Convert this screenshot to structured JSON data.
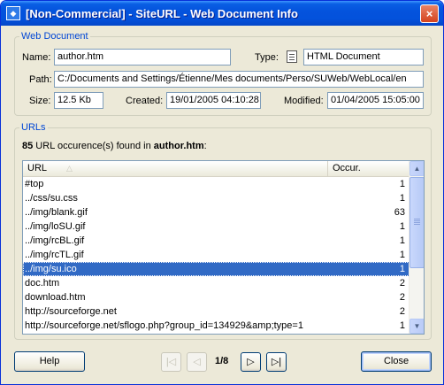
{
  "window": {
    "title": "[Non-Commercial] - SiteURL - Web Document Info",
    "close_glyph": "×"
  },
  "web_document": {
    "legend": "Web Document",
    "name_label": "Name:",
    "name_value": "author.htm",
    "type_label": "Type:",
    "type_icon": "document-icon",
    "type_value": "HTML Document",
    "path_label": "Path:",
    "path_value": "C:/Documents and Settings/Étienne/Mes documents/Perso/SUWeb/WebLocal/en",
    "size_label": "Size:",
    "size_value": "12.5 Kb",
    "created_label": "Created:",
    "created_value": "19/01/2005 04:10:28",
    "modified_label": "Modified:",
    "modified_value": "01/04/2005 15:05:00"
  },
  "urls": {
    "legend": "URLs",
    "summary_count": "85",
    "summary_text": " URL occurence(s) found in ",
    "summary_file": "author.htm",
    "summary_suffix": ":",
    "columns": {
      "url": "URL",
      "occur": "Occur."
    },
    "sort_glyph": "△",
    "rows": [
      {
        "url": "#top",
        "occur": "1"
      },
      {
        "url": "../css/su.css",
        "occur": "1"
      },
      {
        "url": "../img/blank.gif",
        "occur": "63"
      },
      {
        "url": "../img/loSU.gif",
        "occur": "1"
      },
      {
        "url": "../img/rcBL.gif",
        "occur": "1"
      },
      {
        "url": "../img/rcTL.gif",
        "occur": "1"
      },
      {
        "url": "../img/su.ico",
        "occur": "1"
      },
      {
        "url": "doc.htm",
        "occur": "2"
      },
      {
        "url": "download.htm",
        "occur": "2"
      },
      {
        "url": "http://sourceforge.net",
        "occur": "2"
      },
      {
        "url": "http://sourceforge.net/sflogo.php?group_id=134929&amp;type=1",
        "occur": "1"
      }
    ],
    "selected_row_index": 6,
    "scroll_up_glyph": "▲",
    "scroll_down_glyph": "▼"
  },
  "footer": {
    "help_label": "Help",
    "first_glyph": "|◁",
    "prev_glyph": "◁",
    "page_indicator": "1/8",
    "next_glyph": "▷",
    "last_glyph": "▷|",
    "close_label": "Close"
  },
  "colors": {
    "title_bar": "#0453dd",
    "legend_text": "#0046d5",
    "selection": "#316ac5",
    "dialog_face": "#ece9d8"
  }
}
